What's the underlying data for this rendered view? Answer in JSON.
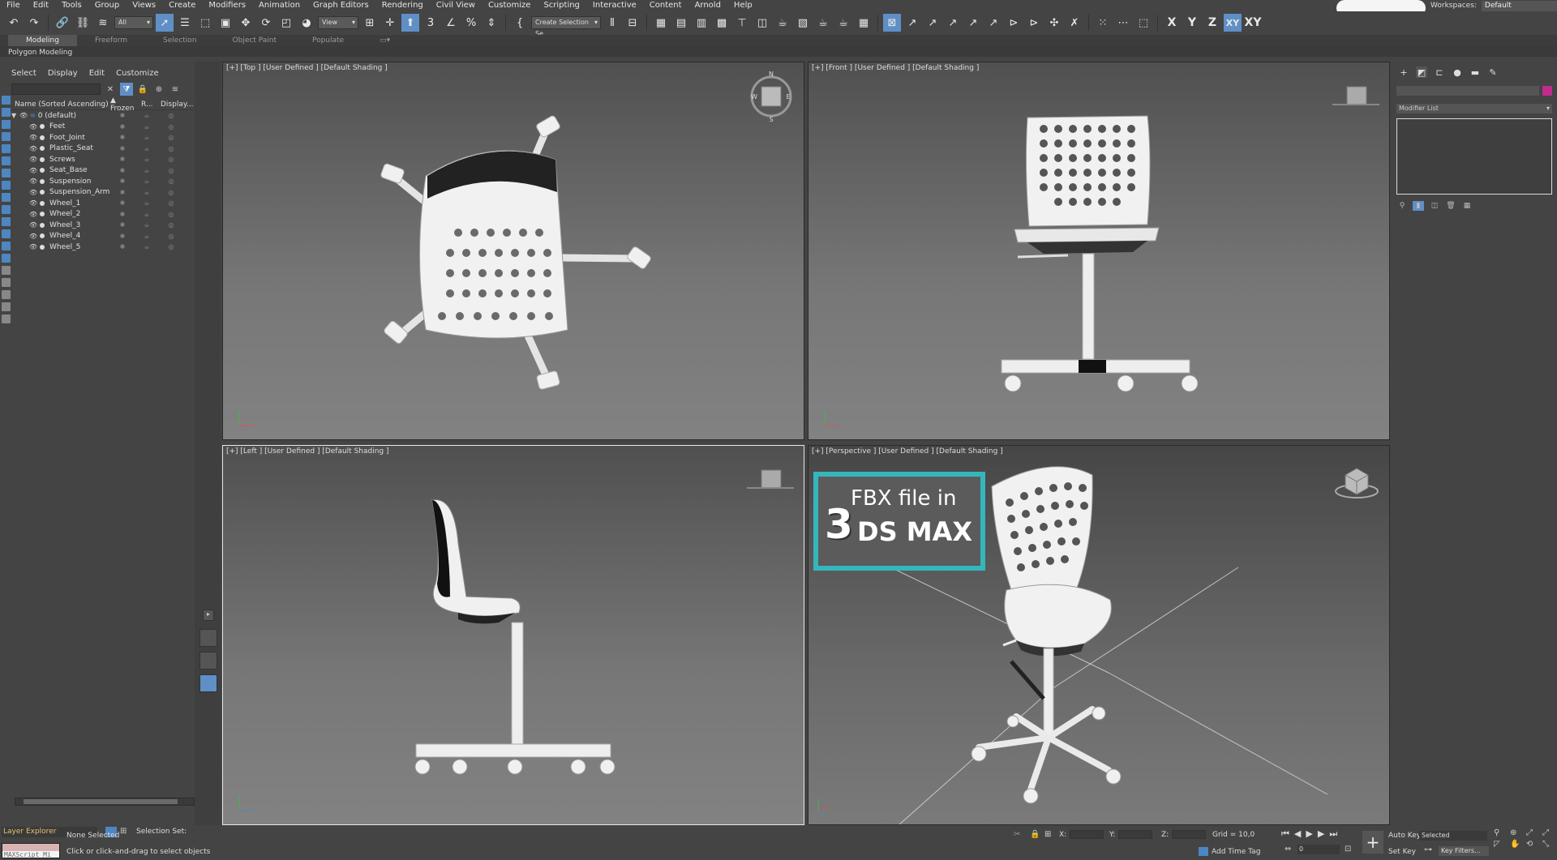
{
  "menu": [
    "File",
    "Edit",
    "Tools",
    "Group",
    "Views",
    "Create",
    "Modifiers",
    "Animation",
    "Graph Editors",
    "Rendering",
    "Civil View",
    "Customize",
    "Scripting",
    "Interactive",
    "Content",
    "Arnold",
    "Help"
  ],
  "workspaces": {
    "label": "Workspaces:",
    "value": "Default"
  },
  "toolbar": {
    "filter_value": "All",
    "ref_coord_value": "View",
    "selection_set_value": "Create Selection Se",
    "axes": [
      "X",
      "Y",
      "Z",
      "XY",
      "XY"
    ]
  },
  "ribbon": {
    "tabs": [
      "Modeling",
      "Freeform",
      "Selection",
      "Object Paint",
      "Populate"
    ],
    "active_tab": "Modeling",
    "panel_label": "Polygon Modeling"
  },
  "explorer": {
    "menu": [
      "Select",
      "Display",
      "Edit",
      "Customize"
    ],
    "columns": {
      "name": "Name (Sorted Ascending)",
      "frozen": "▲ Frozen",
      "r": "R...",
      "display": "Display..."
    },
    "layer": "0 (default)",
    "objects": [
      "Feet",
      "Foot_Joint",
      "Plastic_Seat",
      "Screws",
      "Seat_Base",
      "Suspension",
      "Suspension_Arm",
      "Wheel_1",
      "Wheel_2",
      "Wheel_3",
      "Wheel_4",
      "Wheel_5"
    ]
  },
  "viewports": {
    "top": "[+] [Top ] [User Defined ] [Default Shading ]",
    "front": "[+] [Front ] [User Defined ] [Default Shading ]",
    "left": "[+] [Left ] [User Defined ] [Default Shading ]",
    "perspective": "[+] [Perspective ] [User Defined ] [Default Shading ]"
  },
  "viewcube": {
    "n": "N",
    "s": "S",
    "e": "E",
    "w": "W"
  },
  "badge": {
    "line1": "FBX file in",
    "three": "3",
    "line2": "DS MAX"
  },
  "command_panel": {
    "modifier_list": "Modifier List",
    "object_color": "#c02c8c"
  },
  "status": {
    "layer_explorer": "Layer Explorer",
    "selection_set": "Selection Set:",
    "maxscript": "MAXScript Mi",
    "selection": "None Selected",
    "prompt": "Click or click-and-drag to select objects",
    "x_label": "X:",
    "y_label": "Y:",
    "z_label": "Z:",
    "grid": "Grid = 10,0",
    "add_time_tag": "Add Time Tag",
    "frame": "0",
    "auto_key": "Auto Key",
    "set_key": "Set Key",
    "key_mode": "Selected",
    "key_filters": "Key Filters..."
  },
  "colors": {
    "accent": "#5f8fc6",
    "badge_border": "#35b6bd",
    "layer_text": "#e9c46a"
  }
}
